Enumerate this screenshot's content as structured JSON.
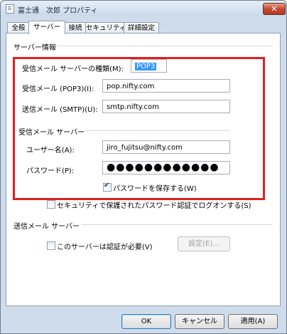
{
  "window": {
    "title": "富士通　次郎 プロパティ",
    "close": "✕"
  },
  "tabs": [
    "全般",
    "サーバー",
    "接続",
    "セキュリティ",
    "詳細設定"
  ],
  "server_info": {
    "heading": "サーバー情報",
    "incoming_type_label": "受信メール サーバーの種類(M):",
    "incoming_type_value": "POP3",
    "incoming_label": "受信メール (POP3)(I):",
    "incoming_value": "pop.nifty.com",
    "outgoing_label": "送信メール (SMTP)(U):",
    "outgoing_value": "smtp.nifty.com"
  },
  "incoming_server": {
    "heading": "受信メール サーバー",
    "username_label": "ユーザー名(A):",
    "username_value": "jiro_fujitsu@nifty.com",
    "password_label": "パスワード(P):",
    "password_value": "●●●●●●●●●●●●",
    "remember_label": "パスワードを保存する(W)",
    "remember_checked": true,
    "spa_label": "セキュリティで保護されたパスワード認証でログオンする(S)"
  },
  "outgoing_server": {
    "heading": "送信メール サーバー",
    "auth_label": "このサーバーは認証が必要(V)",
    "settings_button": "設定(E)..."
  },
  "buttons": {
    "ok": "OK",
    "cancel": "キャンセル",
    "apply": "適用(A)"
  }
}
